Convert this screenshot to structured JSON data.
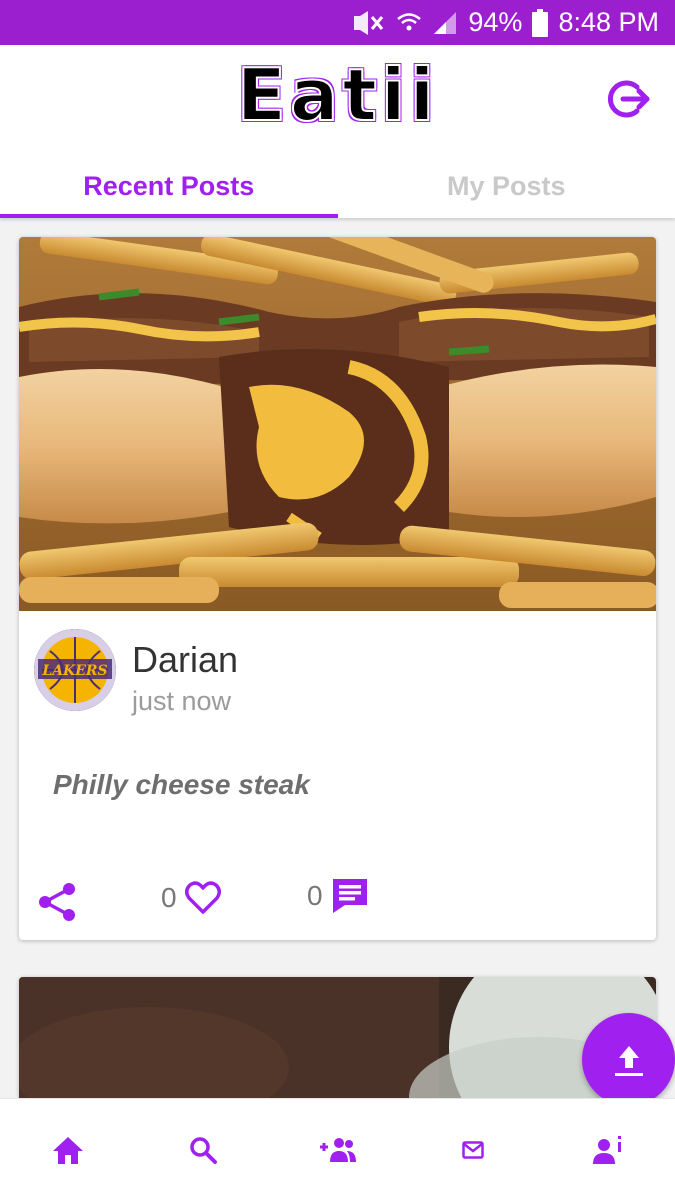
{
  "status_bar": {
    "battery": "94%",
    "time": "8:48 PM",
    "icons": [
      "mute-icon",
      "wifi-icon",
      "signal-icon",
      "battery-icon"
    ]
  },
  "app_bar": {
    "title": "Eatii",
    "logout_icon": "logout-icon"
  },
  "tabs": [
    {
      "label": "Recent Posts",
      "active": true
    },
    {
      "label": "My Posts",
      "active": false
    }
  ],
  "post": {
    "author": "Darian",
    "time": "just now",
    "caption": "Philly cheese steak",
    "likes": "0",
    "comments": "0",
    "avatar_text": "LAKERS"
  },
  "bottom_nav": [
    "home-icon",
    "search-icon",
    "friends-icon",
    "messages-icon",
    "profile-icon"
  ],
  "colors": {
    "accent": "#a020f0",
    "status_bar": "#9c1fcf"
  }
}
